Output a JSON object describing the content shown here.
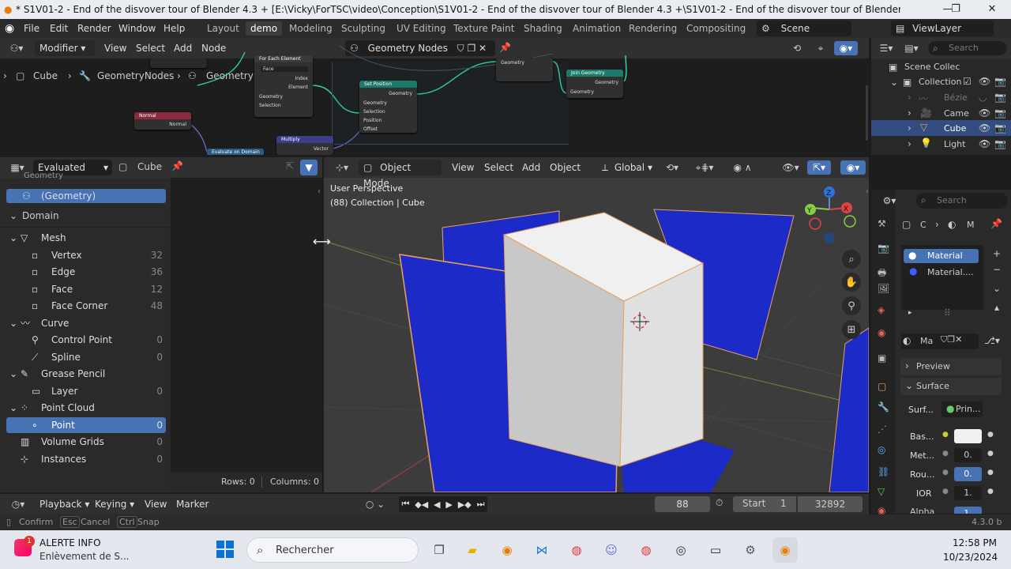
{
  "window": {
    "title": "* S1V01-2 - End of the disvover tour of Blender 4.3 + [E:\\Vicky\\ForTSC\\video\\Conception\\S1V01-2 - End of the disvover tour of Blender 4.3 +\\S1V01-2 - End of the disvover tour of Blender 4.3 +.blend] - Blender...",
    "minimize": "—",
    "maximize": "❐",
    "close": "✕"
  },
  "menu": {
    "items": [
      "File",
      "Edit",
      "Render",
      "Window",
      "Help"
    ],
    "workspaces": [
      "Layout",
      "demo",
      "Modeling",
      "Sculpting",
      "UV Editing",
      "Texture Paint",
      "Shading",
      "Animation",
      "Rendering",
      "Compositing"
    ],
    "scene": "Scene",
    "view_layer": "ViewLayer"
  },
  "node_editor": {
    "editor_type": "Modifier",
    "menus": [
      "View",
      "Select",
      "Add",
      "Node"
    ],
    "tree_name": "Geometry Nodes",
    "breadcrumb": [
      "Cube",
      "GeometryNodes",
      "Geometry Nodes"
    ],
    "nodes": {
      "for_each": {
        "title": "For Each Element",
        "domain": "Face",
        "rows": [
          "Index",
          "Element",
          "Geometry",
          "Selection"
        ]
      },
      "set_position": {
        "title": "Set Position",
        "out": "Geometry",
        "rows": [
          "Geometry",
          "Selection",
          "Position",
          "Offset"
        ]
      },
      "join": {
        "title": "Join Geometry",
        "out": "Geometry",
        "in": "Geometry"
      },
      "top_geo": {
        "label": "Geometry"
      },
      "normal": {
        "title": "Normal",
        "out": "Normal"
      },
      "multiply": {
        "title": "Multiply",
        "out": "Vector"
      },
      "eval": {
        "title": "Evaluate on Domain"
      }
    }
  },
  "spreadsheet": {
    "mode": "Evaluated",
    "object": "Cube",
    "partial_top": "Geometry",
    "geometry_label": "(Geometry)",
    "domain_label": "Domain",
    "groups": [
      {
        "name": "Mesh",
        "items": [
          {
            "name": "Vertex",
            "count": "32"
          },
          {
            "name": "Edge",
            "count": "36"
          },
          {
            "name": "Face",
            "count": "12"
          },
          {
            "name": "Face Corner",
            "count": "48"
          }
        ]
      },
      {
        "name": "Curve",
        "items": [
          {
            "name": "Control Point",
            "count": "0"
          },
          {
            "name": "Spline",
            "count": "0"
          }
        ]
      },
      {
        "name": "Grease Pencil",
        "items": [
          {
            "name": "Layer",
            "count": "0"
          }
        ]
      },
      {
        "name": "Point Cloud",
        "items": [
          {
            "name": "Point",
            "count": "0"
          }
        ]
      }
    ],
    "volume_grids": {
      "name": "Volume Grids",
      "count": "0"
    },
    "instances": {
      "name": "Instances",
      "count": "0"
    },
    "rows": "Rows: 0",
    "columns": "Columns: 0"
  },
  "viewport": {
    "mode": "Object Mode",
    "menus": [
      "View",
      "Select",
      "Add",
      "Object"
    ],
    "orientation": "Global",
    "overlay_title": "User Perspective",
    "overlay_sub": "(88) Collection | Cube",
    "gizmo": {
      "x": "X",
      "y": "Y",
      "z": "Z"
    }
  },
  "timeline": {
    "menus": [
      "Playback",
      "Keying",
      "View",
      "Marker"
    ],
    "current_frame": "88",
    "start_label": "Start",
    "start": "1",
    "end": "32892"
  },
  "status": {
    "confirm": "Confirm",
    "cancel_key": "Esc",
    "cancel": "Cancel",
    "snap_key": "Ctrl",
    "snap": "Snap",
    "version": "4.3.0 b"
  },
  "outliner": {
    "search_placeholder": "Search",
    "scene_collection": "Scene Collec",
    "collection": "Collection",
    "items": [
      "Bézie",
      "Came",
      "Cube",
      "Light"
    ]
  },
  "properties": {
    "search_placeholder": "Search",
    "breadcrumb_obj": "C",
    "breadcrumb_mat": "M",
    "slots": [
      "Material",
      "Material...."
    ],
    "material_name": "Ma",
    "preview": "Preview",
    "surface": "Surface",
    "surface_label": "Surf...",
    "surface_value": "Prin...",
    "base_color": "Bas...",
    "metallic": "Met...",
    "metallic_value": "0.",
    "roughness": "Rou...",
    "roughness_value": "0.",
    "ior": "IOR",
    "ior_value": "1.",
    "alpha": "Alpha",
    "alpha_value": "1."
  },
  "taskbar": {
    "notif_badge": "1",
    "notif_title": "ALERTE INFO",
    "notif_text": "Enlèvement de S...",
    "search_placeholder": "Rechercher",
    "time": "12:58 PM",
    "date": "10/23/2024"
  },
  "colors": {
    "accent": "#4772b3",
    "plane_blue": "#1c2bc8",
    "outline": "#e8a060"
  }
}
